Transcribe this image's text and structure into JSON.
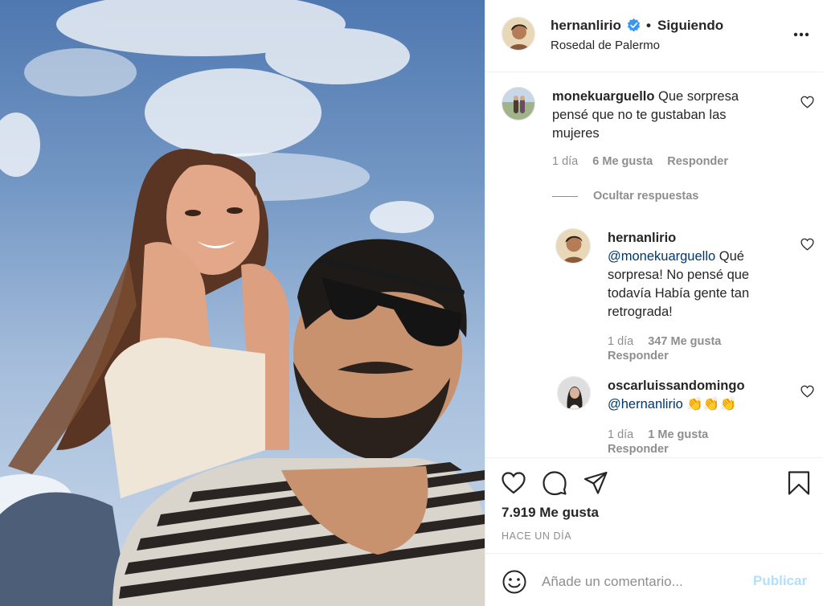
{
  "post": {
    "author": "hernanlirio",
    "follow_status": "Siguiendo",
    "location": "Rosedal de Palermo",
    "likes": "7.919 Me gusta",
    "time_ago": "HACE UN DÍA"
  },
  "comments": [
    {
      "user": "monekuarguello",
      "text": "Que sorpresa",
      "text_line2": "pensé que no te gustaban las",
      "text_line3": "mujeres",
      "age": "1 día",
      "likes": "6 Me gusta",
      "reply_label": "Responder",
      "hide_replies_label": "Ocultar respuestas",
      "replies": [
        {
          "user": "hernanlirio",
          "mention": "@monekuarguello",
          "text_line1": "Qué",
          "text_line2": "sorpresa! No pensé que",
          "text_line3": "todavía Había gente tan",
          "text_line4": "retrograda!",
          "age": "1 día",
          "likes": "347 Me gusta",
          "reply_label": "Responder"
        },
        {
          "user": "oscarluissandomingo",
          "mention": "@hernanlirio",
          "emoji": "👏👏👏",
          "age": "1 día",
          "likes": "1 Me gusta",
          "reply_label": "Responder"
        }
      ]
    }
  ],
  "add_comment": {
    "placeholder": "Añade un comentario...",
    "publish_label": "Publicar"
  },
  "icons": {
    "more": "more-options-icon",
    "like": "heart-icon",
    "comment": "comment-icon",
    "share": "share-icon",
    "save": "bookmark-icon",
    "emoji": "emoji-icon",
    "verified": "verified-badge-icon"
  },
  "colors": {
    "verified": "#3897f0",
    "publish_disabled": "#b2dffc",
    "mention": "#00376b",
    "secondary_text": "#8e8e8e"
  }
}
